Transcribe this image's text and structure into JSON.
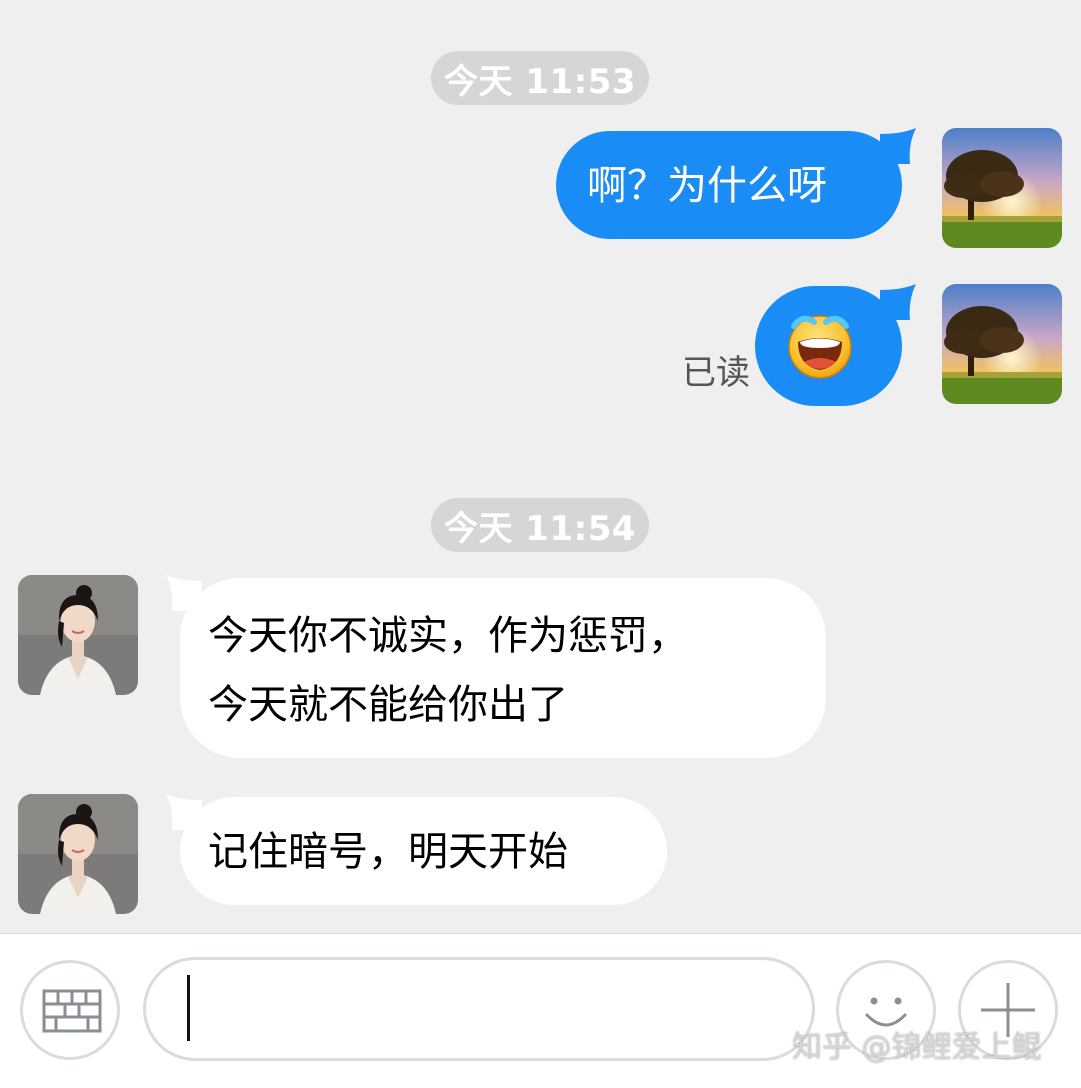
{
  "conversation": {
    "timestamps": [
      "今天 11:53",
      "今天 11:54"
    ],
    "messages": [
      {
        "sender": "me",
        "type": "text",
        "text": "啊？为什么呀"
      },
      {
        "sender": "me",
        "type": "emoji",
        "emoji": "crying-face-emoji",
        "status": "已读"
      },
      {
        "sender": "contact",
        "type": "text",
        "lines": [
          "今天你不诚实，作为惩罚，",
          "今天就不能给你出了"
        ]
      },
      {
        "sender": "contact",
        "type": "text",
        "text": "记住暗号，明天开始"
      }
    ]
  },
  "input_bar": {
    "value": "",
    "icons": [
      "keyboard-icon",
      "emoji-smile-icon",
      "plus-icon"
    ]
  },
  "watermark": "知乎 @锦鲤爱上鲲",
  "colors": {
    "background": "#efefef",
    "outgoing_bubble": "#1a8cf5",
    "incoming_bubble": "#ffffff",
    "timestamp_pill": "#d6d6d6"
  }
}
